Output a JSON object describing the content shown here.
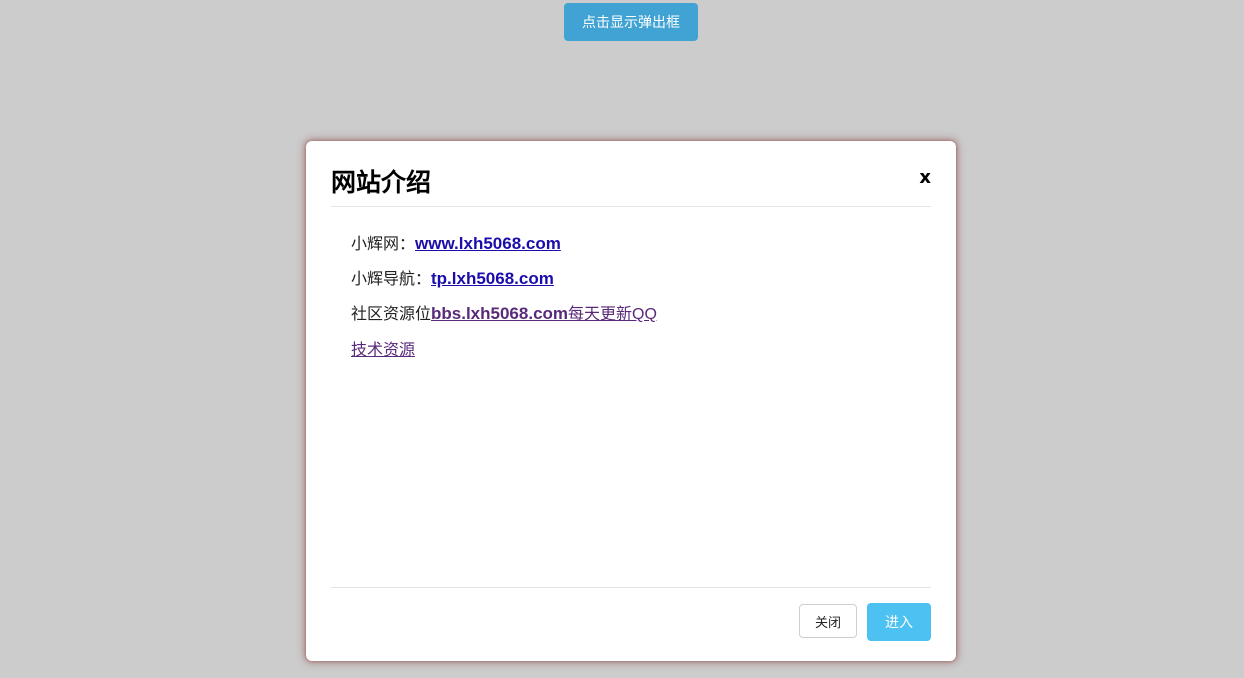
{
  "page": {
    "show_button_label": "点击显示弹出框"
  },
  "modal": {
    "title": "网站介绍",
    "close_icon_text": "x",
    "lines": [
      {
        "prefix": "小辉网：",
        "link": "www.lxh5068.com"
      },
      {
        "prefix": "小辉导航：",
        "link": "tp.lxh5068.com"
      },
      {
        "prefix": "社区资源位",
        "link": "bbs.lxh5068.com",
        "suffix_link": "每天更新QQ"
      },
      {
        "link": "技术资源"
      }
    ],
    "footer": {
      "close_label": "关闭",
      "enter_label": "进入"
    }
  },
  "colors": {
    "background": "#cccccc",
    "show_button": "#41a3d3",
    "enter_button": "#4cc1f2",
    "link": "#1a0dab",
    "visited_link": "#5a2a7a"
  }
}
